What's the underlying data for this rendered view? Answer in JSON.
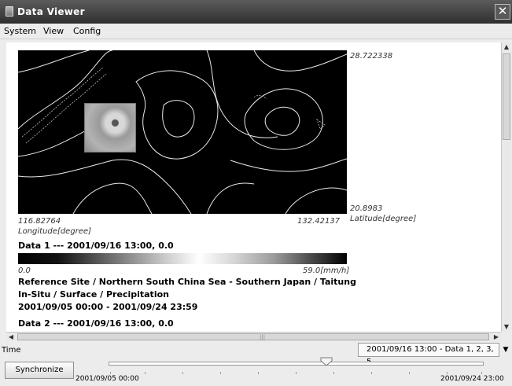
{
  "window": {
    "title": "Data Viewer",
    "close_glyph": "✕"
  },
  "menu": [
    "System",
    "View",
    "Config"
  ],
  "map": {
    "lat_max": "28.722338",
    "lat_min": "20.8983",
    "lat_label": "Latitude[degree]",
    "lon_min": "116.82764",
    "lon_max": "132.42137",
    "lon_label": "Longitude[degree]"
  },
  "data1": {
    "heading": "Data 1 --- 2001/09/16 13:00, 0.0",
    "scale_min": "0.0",
    "scale_max": "59.0[mm/h]",
    "site": "Reference Site / Northern South China Sea - Southern Japan / Taitung",
    "kind": "In-Situ / Surface / Precipitation",
    "period": "2001/09/05 00:00 - 2001/09/24 23:59"
  },
  "data2": {
    "heading": "Data 2 --- 2001/09/16 13:00, 0.0"
  },
  "time": {
    "label": "Time",
    "selected": "2001/09/16 13:00 - Data 1, 2, 3, 5",
    "start": "2001/09/05 00:00",
    "end": "2001/09/24 23:00",
    "position": 0.57
  },
  "sync_button": "Synchronize",
  "icons": {
    "window": "window-icon",
    "close": "close-icon",
    "dropdown": "chevron-down-icon",
    "scroll_up": "arrow-up-icon",
    "scroll_down": "arrow-down-icon",
    "scroll_left": "arrow-left-icon",
    "scroll_right": "arrow-right-icon"
  }
}
